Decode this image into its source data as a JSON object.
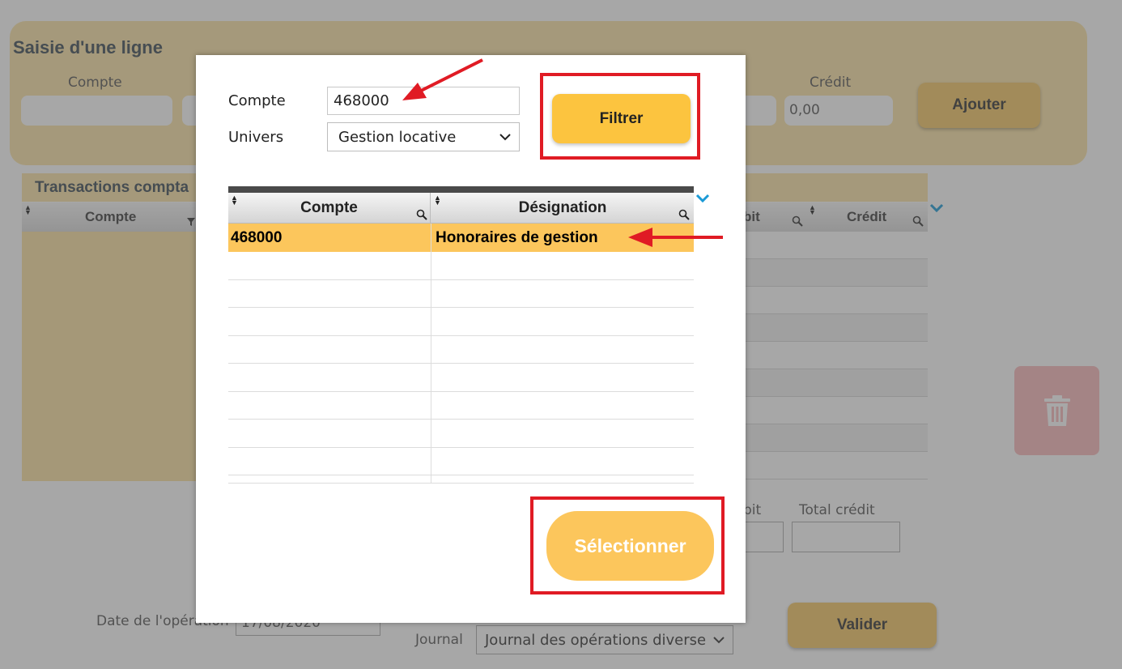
{
  "background": {
    "saisie": {
      "title": "Saisie d'une ligne",
      "compte_label": "Compte",
      "credit_label": "Crédit",
      "credit_value": "0,00",
      "ajouter_label": "Ajouter"
    },
    "transactions": {
      "title": "Transactions compta",
      "col_compte": "Compte",
      "col_debit_partial": "bit",
      "col_credit": "Crédit"
    },
    "totals": {
      "total_debit_partial": "bit",
      "total_credit_label": "Total crédit"
    },
    "date_label": "Date de l'opération",
    "date_value": "17/08/2020",
    "journal_label": "Journal",
    "journal_value": "Journal des opérations diverse",
    "valider_label": "Valider"
  },
  "modal": {
    "compte_label": "Compte",
    "compte_value": "468000",
    "univers_label": "Univers",
    "univers_value": "Gestion locative",
    "filtrer_label": "Filtrer",
    "grid": {
      "columns": [
        "Compte",
        "Désignation"
      ],
      "rows": [
        {
          "compte": "468000",
          "designation": "Honoraires de gestion"
        }
      ]
    },
    "selectionner_label": "Sélectionner"
  },
  "colors": {
    "accent_yellow": "#fcc43f",
    "highlight_row": "#fcc65c",
    "annotation_red": "#e01b24",
    "chevron_blue": "#1a9ad6"
  }
}
